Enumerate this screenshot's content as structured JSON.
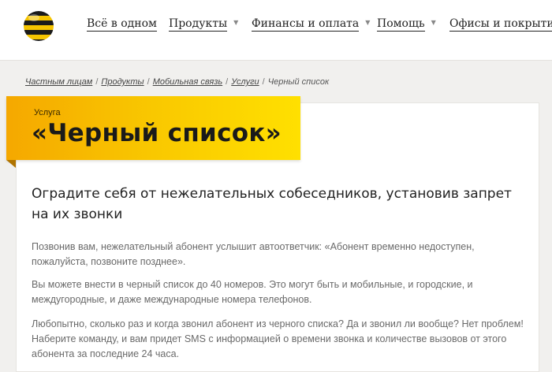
{
  "header": {
    "logo": "beeline-logo",
    "nav": [
      {
        "label": "Всё в одном",
        "has_dropdown": false
      },
      {
        "label": "Продукты",
        "has_dropdown": true
      },
      {
        "label": "Финансы и оплата",
        "has_dropdown": true
      },
      {
        "label": "Помощь",
        "has_dropdown": true
      },
      {
        "label": "Офисы и покрытие",
        "has_dropdown": false
      }
    ],
    "caret": "▼"
  },
  "breadcrumb": {
    "items": [
      "Частным лицам",
      "Продукты",
      "Мобильная связь",
      "Услуги"
    ],
    "separator": "/",
    "current": "Черный список"
  },
  "banner": {
    "kicker": "Услуга",
    "title": "«Черный список»",
    "color": "#f9c800"
  },
  "content": {
    "lead": "Оградите себя от нежелательных собеседников, установив запрет на их звонки",
    "paragraphs": [
      "Позвонив вам, нежелательный абонент услышит автоответчик: «Абонент временно недоступен, пожалуйста, позвоните позднее».",
      "Вы можете внести в черный список до 40 номеров. Это могут быть и мобильные, и городские, и междугородные, и даже международные номера телефонов.",
      "Любопытно, сколько раз и когда звонил абонент из черного списка? Да и звонил ли вообще? Нет проблем! Наберите команду, и вам придет SMS с информацией о времени звонка и количестве вызовов от этого абонента за последние 24 часа."
    ]
  }
}
